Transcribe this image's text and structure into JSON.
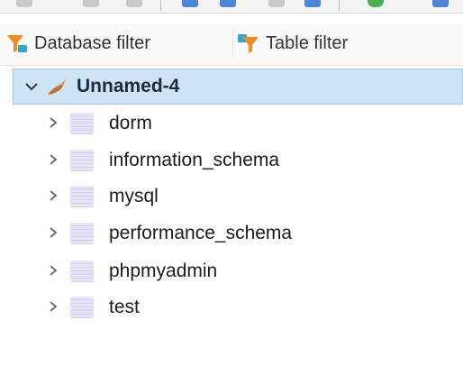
{
  "filters": {
    "database_filter": "Database filter",
    "table_filter": "Table filter",
    "icon": "filter-icon"
  },
  "tree": {
    "root": {
      "label": "Unnamed-4",
      "expanded": true,
      "icon": "connection-icon"
    },
    "schemas": [
      {
        "label": "dorm"
      },
      {
        "label": "information_schema"
      },
      {
        "label": "mysql"
      },
      {
        "label": "performance_schema"
      },
      {
        "label": "phpmyadmin"
      },
      {
        "label": "test"
      }
    ]
  },
  "colors": {
    "selection_bg": "#cfe3f7",
    "selection_border": "#a9c9ec",
    "funnel_orange": "#f08a24",
    "funnel_teal": "#3aa3c8"
  }
}
